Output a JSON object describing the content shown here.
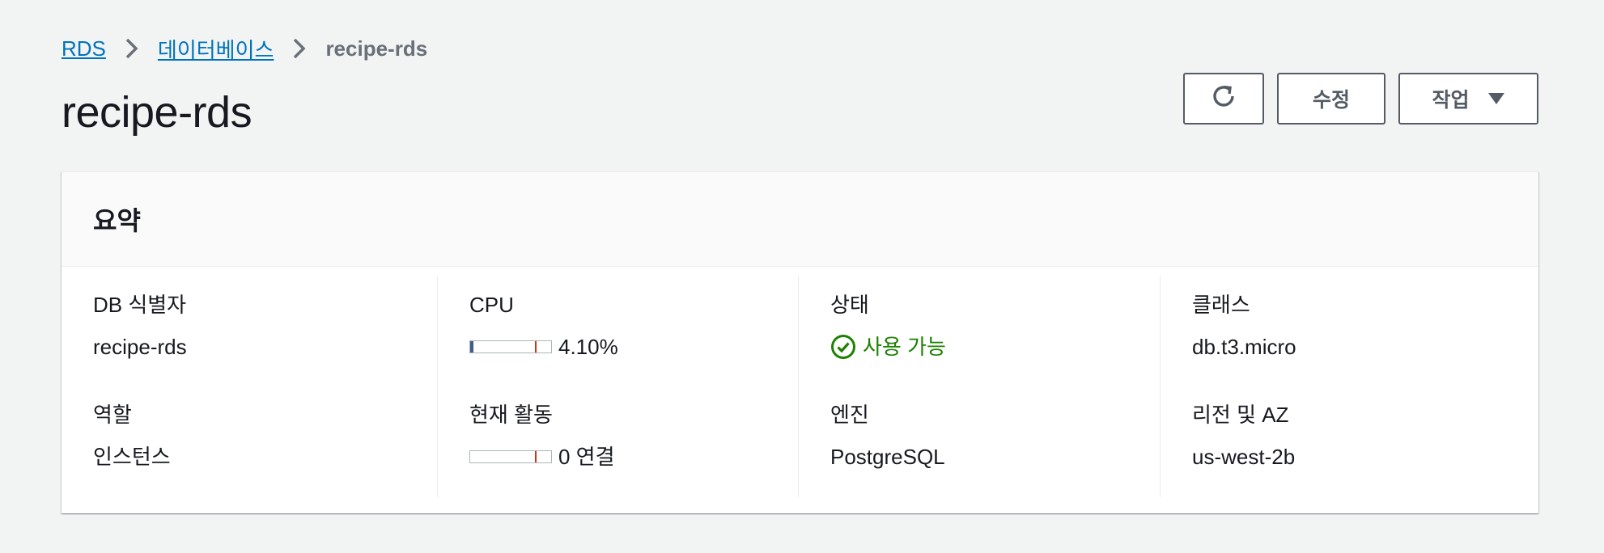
{
  "breadcrumb": {
    "items": [
      "RDS",
      "데이터베이스"
    ],
    "current": "recipe-rds"
  },
  "page_title": "recipe-rds",
  "header_actions": {
    "refresh_icon": "refresh-icon",
    "edit_label": "수정",
    "actions_label": "작업",
    "actions_icon": "caret-down-icon"
  },
  "summary": {
    "title": "요약",
    "db_identifier": {
      "label": "DB 식별자",
      "value": "recipe-rds"
    },
    "role": {
      "label": "역할",
      "value": "인스턴스"
    },
    "cpu": {
      "label": "CPU",
      "value": "4.10%",
      "meter_fraction": 0.041,
      "threshold_fraction": 0.8
    },
    "current_activity": {
      "label": "현재 활동",
      "value": "0 연결",
      "meter_fraction": 0.0,
      "threshold_fraction": 0.8
    },
    "status": {
      "label": "상태",
      "value": "사용 가능",
      "icon": "check-circle-icon"
    },
    "engine": {
      "label": "엔진",
      "value": "PostgreSQL"
    },
    "class": {
      "label": "클래스",
      "value": "db.t3.micro"
    },
    "region_az": {
      "label": "리전 및 AZ",
      "value": "us-west-2b"
    }
  },
  "colors": {
    "link": "#0073bb",
    "status_ok": "#1d8102",
    "meter_fill": "#3f5e8c",
    "meter_threshold": "#d13212",
    "background": "#f2f3f3"
  }
}
